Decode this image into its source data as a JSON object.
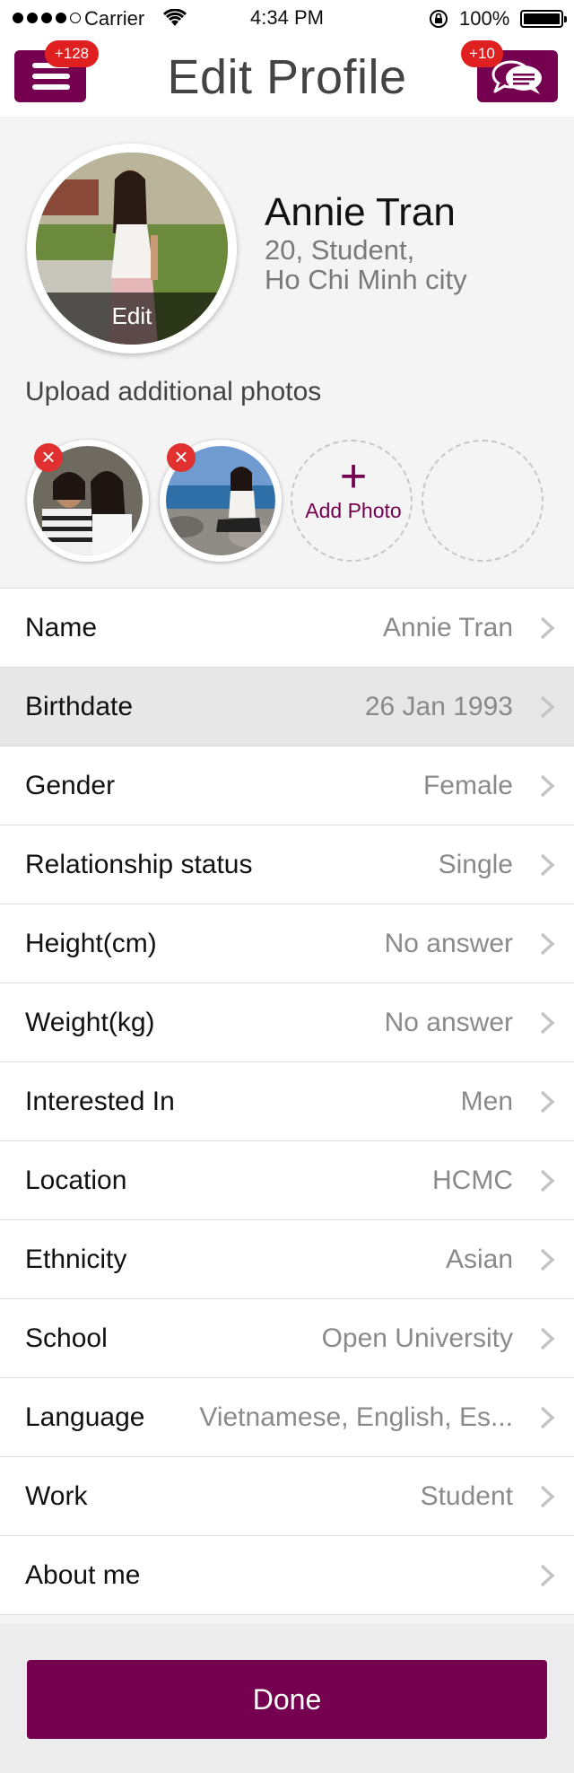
{
  "status_bar": {
    "carrier": "Carrier",
    "time": "4:34 PM",
    "battery": "100%"
  },
  "header": {
    "title": "Edit Profile",
    "menu_badge": "+128",
    "chat_badge": "+10"
  },
  "profile": {
    "name": "Annie Tran",
    "meta_line1": "20, Student,",
    "meta_line2": "Ho Chi Minh city",
    "edit_label": "Edit"
  },
  "photos": {
    "upload_label": "Upload additional photos",
    "add_label": "Add Photo"
  },
  "fields": [
    {
      "label": "Name",
      "value": "Annie Tran"
    },
    {
      "label": "Birthdate",
      "value": "26 Jan 1993"
    },
    {
      "label": "Gender",
      "value": "Female"
    },
    {
      "label": "Relationship status",
      "value": "Single"
    },
    {
      "label": "Height(cm)",
      "value": "No answer"
    },
    {
      "label": "Weight(kg)",
      "value": "No answer"
    },
    {
      "label": "Interested In",
      "value": "Men"
    },
    {
      "label": "Location",
      "value": "HCMC"
    },
    {
      "label": "Ethnicity",
      "value": "Asian"
    },
    {
      "label": "School",
      "value": "Open University"
    },
    {
      "label": "Language",
      "value": "Vietnamese, English, Es..."
    },
    {
      "label": "Work",
      "value": "Student"
    },
    {
      "label": "About me",
      "value": ""
    }
  ],
  "done_label": "Done",
  "colors": {
    "accent": "#760050",
    "badge": "#e02020",
    "highlight_row": "#e7e7e7"
  }
}
